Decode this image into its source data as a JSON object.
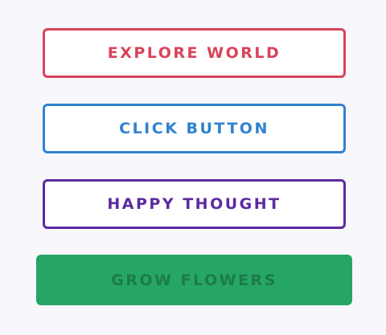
{
  "buttons": {
    "explore": {
      "label": "EXPLORE WORLD",
      "color": "#d8435a"
    },
    "click": {
      "label": "CLICK BUTTON",
      "color": "#2f82d0"
    },
    "happy": {
      "label": "HAPPY THOUGHT",
      "color": "#5b2ba1"
    },
    "grow": {
      "label": "GROW FLOWERS",
      "color": "#26a664"
    }
  }
}
